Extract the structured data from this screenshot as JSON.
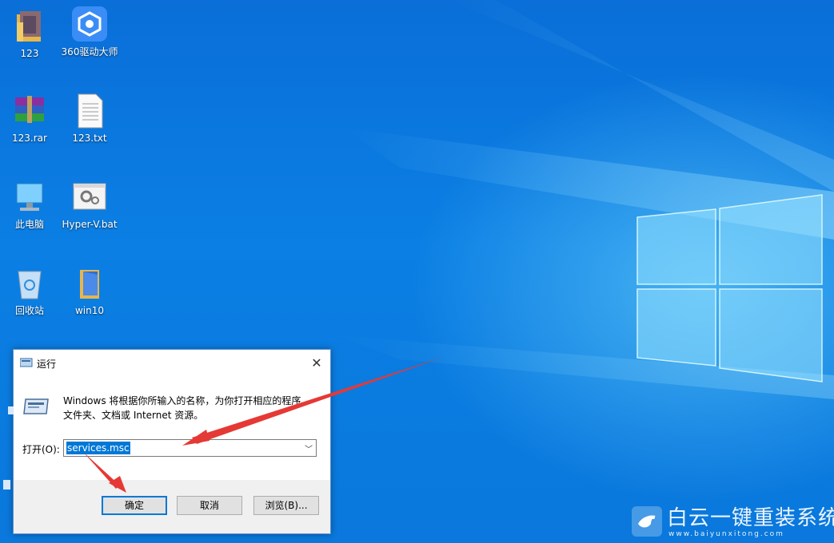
{
  "desktop": {
    "icons": [
      {
        "label": "123",
        "icon": "folder-icon"
      },
      {
        "label": "360驱动大师",
        "icon": "driver-app-icon"
      },
      {
        "label": "123.rar",
        "icon": "rar-archive-icon"
      },
      {
        "label": "123.txt",
        "icon": "text-file-icon"
      },
      {
        "label": "此电脑",
        "icon": "computer-icon"
      },
      {
        "label": "Hyper-V.bat",
        "icon": "batch-file-icon"
      },
      {
        "label": "回收站",
        "icon": "recycle-bin-icon"
      },
      {
        "label": "win10",
        "icon": "folder-icon"
      }
    ]
  },
  "run_dialog": {
    "title": "运行",
    "close_glyph": "✕",
    "description_line1": "Windows 将根据你所输入的名称，为你打开相应的程序、",
    "description_line2": "文件夹、文档或 Internet 资源。",
    "open_label": "打开(O):",
    "input_value": "services.msc",
    "buttons": {
      "ok": "确定",
      "cancel": "取消",
      "browse": "浏览(B)..."
    }
  },
  "watermark": {
    "name": "白云一键重装系统",
    "domain": "www.baiyunxitong.com"
  },
  "colors": {
    "desktop_blue": "#0a78dc",
    "accent": "#0078d7",
    "arrow_red": "#e53935"
  }
}
